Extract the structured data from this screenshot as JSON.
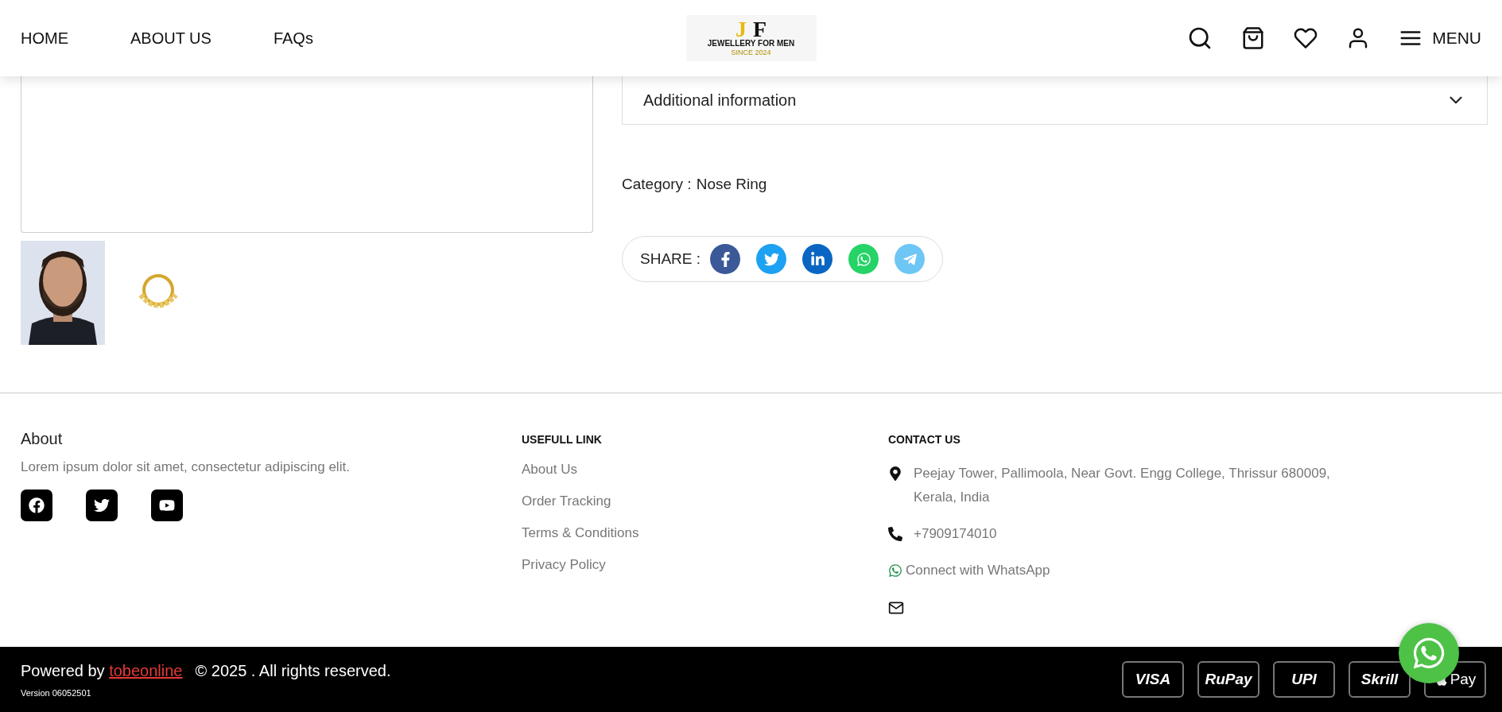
{
  "nav": {
    "links": [
      {
        "label": "HOME"
      },
      {
        "label": "ABOUT US"
      },
      {
        "label": "FAQs"
      }
    ],
    "logo": {
      "letter_left": "J",
      "letter_right": "F",
      "name": "JEWELLERY FOR MEN",
      "tagline": "SINCE 2024"
    },
    "menu_label": "MENU"
  },
  "gallery": {
    "thumbnails": [
      {
        "kind": "picture"
      },
      {
        "kind": "ring"
      }
    ]
  },
  "details": {
    "accordion": {
      "title": "Additional information",
      "expanded": false
    },
    "category_label": "Category :",
    "category": "Nose Ring",
    "share_label": "SHARE :",
    "share": [
      {
        "kind": "facebook",
        "color": "#3b5998"
      },
      {
        "kind": "twitter",
        "color": "#1da1f2"
      },
      {
        "kind": "linkedin",
        "color": "#0a66c2"
      },
      {
        "kind": "whatsapp",
        "color": "#25d366"
      },
      {
        "kind": "telegram",
        "color": "#6ec6f5"
      }
    ]
  },
  "footer": {
    "about": {
      "title": "About",
      "text": "Lorem ipsum dolor sit amet, consectetur adipiscing elit.",
      "social": [
        {
          "kind": "facebook"
        },
        {
          "kind": "twitter"
        },
        {
          "kind": "youtube"
        }
      ]
    },
    "links": {
      "title": "USEFULL LINK",
      "items": [
        "About Us",
        "Order Tracking",
        "Terms & Conditions",
        "Privacy Policy"
      ]
    },
    "contact": {
      "title": "CONTACT US",
      "address": "Peejay Tower, Pallimoola, Near Govt. Engg College, Thrissur 680009, Kerala, India",
      "phone": "+7909174010",
      "whatsapp": "Connect with WhatsApp"
    }
  },
  "bottom_bar": {
    "powered_by": "Powered by",
    "brand": "tobeonline",
    "rights": "© 2025 . All rights reserved.",
    "version": "Version 06052501",
    "payments": [
      {
        "kind": "visa",
        "label": "VISA"
      },
      {
        "kind": "rupay",
        "label": "RuPay"
      },
      {
        "kind": "upi",
        "label": "UPI"
      },
      {
        "kind": "skrill",
        "label": "Skrill"
      },
      {
        "kind": "applepay",
        "label": "Pay"
      }
    ]
  }
}
